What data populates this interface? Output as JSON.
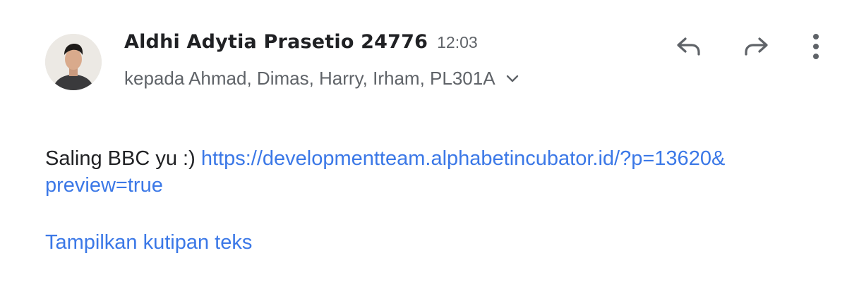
{
  "email": {
    "sender_name": "Aldhi Adytia Prasetio 24776",
    "time": "12:03",
    "recipients": "kepada Ahmad, Dimas, Harry, Irham, PL301A",
    "body_prefix": "Saling BBC yu :) ",
    "link_line1": "https://developmentteam.alphabetincubator.id/?p=13620&",
    "link_line2": "preview=true",
    "show_quoted_label": "Tampilkan kutipan teks"
  },
  "icons": {
    "reply": "reply-icon",
    "forward": "forward-icon",
    "more": "more-vert-icon",
    "expand": "chevron-down-icon"
  },
  "colors": {
    "text_primary": "#202124",
    "text_secondary": "#5f6368",
    "link": "#3b78e7"
  }
}
